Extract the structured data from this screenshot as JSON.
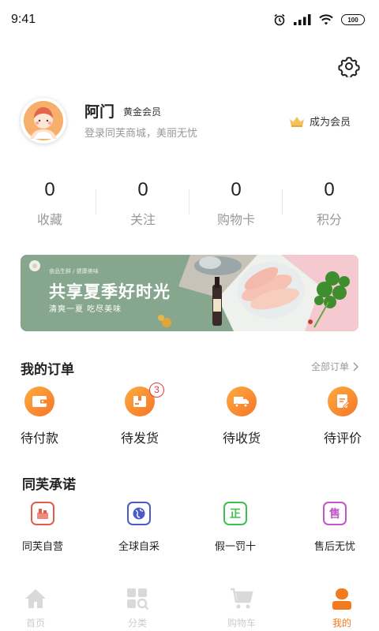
{
  "status_bar": {
    "time": "9:41",
    "battery": "100"
  },
  "profile": {
    "name": "阿门",
    "level": "黄金会员",
    "subtitle": "登录同芙商城，美丽无忧",
    "become_member": "成为会员"
  },
  "stats": [
    {
      "value": "0",
      "label": "收藏"
    },
    {
      "value": "0",
      "label": "关注"
    },
    {
      "value": "0",
      "label": "购物卡"
    },
    {
      "value": "0",
      "label": "积分"
    }
  ],
  "banner": {
    "tag": "食品生鲜 / 健康美味",
    "title": "共享夏季好时光",
    "subtitle": "清爽一夏 吃尽美味"
  },
  "orders": {
    "title": "我的订单",
    "all_label": "全部订单",
    "items": [
      {
        "label": "待付款",
        "icon": "wallet-icon"
      },
      {
        "label": "待发货",
        "icon": "package-icon",
        "badge": "3"
      },
      {
        "label": "待收货",
        "icon": "truck-icon"
      },
      {
        "label": "待评价",
        "icon": "review-icon"
      }
    ]
  },
  "promise": {
    "title": "同芙承诺",
    "items": [
      {
        "label": "同芙自营",
        "icon": "store-icon",
        "color": "#e25c4b"
      },
      {
        "label": "全球自采",
        "icon": "globe-icon",
        "color": "#4a5bc4"
      },
      {
        "label": "假一罚十",
        "icon": "genuine-icon",
        "glyph": "正",
        "color": "#3fbf4f"
      },
      {
        "label": "售后无忧",
        "icon": "aftersale-icon",
        "glyph": "售",
        "color": "#c255c9"
      }
    ]
  },
  "tabs": [
    {
      "label": "首页",
      "icon": "home-icon"
    },
    {
      "label": "分类",
      "icon": "category-icon"
    },
    {
      "label": "购物车",
      "icon": "cart-icon"
    },
    {
      "label": "我的",
      "icon": "profile-icon",
      "active": true
    }
  ],
  "colors": {
    "accent": "#f47a1f",
    "banner": "#86a78e"
  }
}
